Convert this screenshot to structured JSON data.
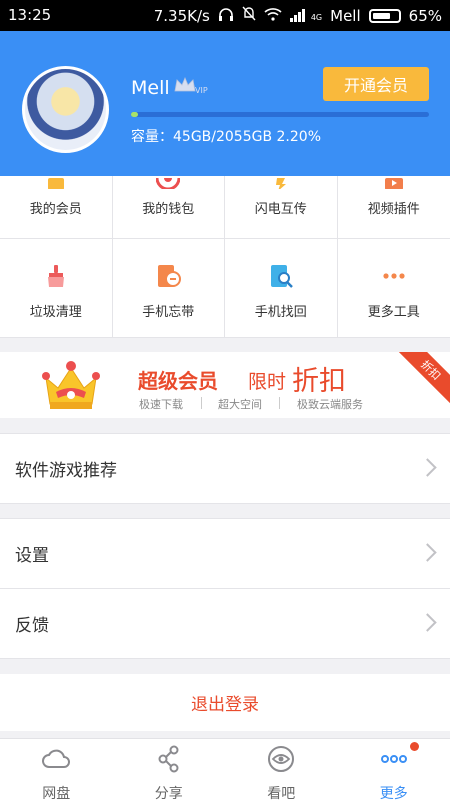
{
  "status_bar": {
    "time": "13:25",
    "speed": "7.35K/s",
    "network_small": "4G",
    "carrier": "Mell",
    "battery": "65%"
  },
  "profile": {
    "name": "Mell",
    "vip_badge": "VIP",
    "open_vip_button": "开通会员",
    "capacity_text": "容量：45GB/2055GB 2.20%",
    "usage_fraction": 0.022
  },
  "grid": {
    "row1": [
      {
        "label": "我的会员",
        "icon": "member-icon"
      },
      {
        "label": "我的钱包",
        "icon": "wallet-icon"
      },
      {
        "label": "闪电互传",
        "icon": "lightning-transfer-icon"
      },
      {
        "label": "视频插件",
        "icon": "video-plugin-icon"
      }
    ],
    "row2": [
      {
        "label": "垃圾清理",
        "icon": "broom-icon"
      },
      {
        "label": "手机忘带",
        "icon": "phone-forgot-icon"
      },
      {
        "label": "手机找回",
        "icon": "phone-find-icon"
      },
      {
        "label": "更多工具",
        "icon": "more-tools-icon"
      }
    ]
  },
  "banner": {
    "title": "超级会员",
    "time_text": "限时",
    "discount_text": "折扣",
    "features": [
      "极速下载",
      "超大空间",
      "极致云端服务"
    ],
    "corner_label": "折扣"
  },
  "menu": {
    "recommend": "软件游戏推荐",
    "settings": "设置",
    "feedback": "反馈",
    "logout": "退出登录"
  },
  "tabs": [
    {
      "label": "网盘",
      "icon": "cloud-icon"
    },
    {
      "label": "分享",
      "icon": "share-icon"
    },
    {
      "label": "看吧",
      "icon": "eye-icon"
    },
    {
      "label": "更多",
      "icon": "more-dots-icon"
    }
  ],
  "colors": {
    "accent": "#3a8ff5",
    "vip_button": "#f9b93c",
    "promo_red": "#e94b2c"
  }
}
